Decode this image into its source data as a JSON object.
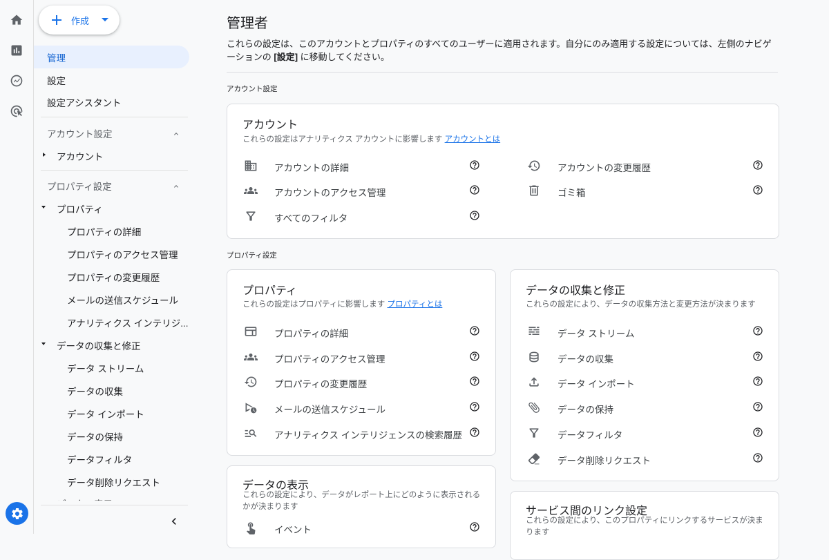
{
  "create": {
    "label": "作成"
  },
  "sidebar": {
    "admin": "管理",
    "settings": "設定",
    "assistant": "設定アシスタント",
    "account_section": "アカウント設定",
    "account_item": "アカウント",
    "property_section": "プロパティ設定",
    "property_item": "プロパティ",
    "property_children": [
      "プロパティの詳細",
      "プロパティのアクセス管理",
      "プロパティの変更履歴",
      "メールの送信スケジュール",
      "アナリティクス インテリジ..."
    ],
    "data_item": "データの収集と修正",
    "data_children": [
      "データ ストリーム",
      "データの収集",
      "データ インポート",
      "データの保持",
      "データフィルタ",
      "データ削除リクエスト"
    ],
    "cut_item": "データの表示"
  },
  "main": {
    "title": "管理者",
    "desc_pre": "これらの設定は、このアカウントとプロパティのすべてのユーザーに適用されます。自分にのみ適用する設定については、左側のナビゲーションの ",
    "desc_bold": "[設定]",
    "desc_post": " に移動してください。",
    "account_group": "アカウント設定",
    "property_group": "プロパティ設定"
  },
  "account_card": {
    "title": "アカウント",
    "sub": "これらの設定はアナリティクス アカウントに影響します ",
    "link": "アカウントとは",
    "left_rows": [
      "アカウントの詳細",
      "アカウントのアクセス管理",
      "すべてのフィルタ"
    ],
    "right_rows": [
      "アカウントの変更履歴",
      "ゴミ箱"
    ]
  },
  "property_card": {
    "title": "プロパティ",
    "sub": "これらの設定はプロパティに影響します ",
    "link": "プロパティとは",
    "rows": [
      "プロパティの詳細",
      "プロパティのアクセス管理",
      "プロパティの変更履歴",
      "メールの送信スケジュール",
      "アナリティクス インテリジェンスの検索履歴"
    ]
  },
  "data_card": {
    "title": "データの収集と修正",
    "sub": "これらの設定により、データの収集方法と変更方法が決まります",
    "rows": [
      "データ ストリーム",
      "データの収集",
      "データ インポート",
      "データの保持",
      "データフィルタ",
      "データ削除リクエスト"
    ]
  },
  "display_card": {
    "title": "データの表示",
    "sub1": "これらの設定により、データがレポート上にどのように表示される",
    "sub2": "かが決まります",
    "rows": [
      "イベント"
    ]
  },
  "link_card": {
    "title": "サービス間のリンク設定",
    "sub1": "これらの設定により、このプロパティにリンクするサービスが決ま",
    "sub2": "ります"
  },
  "colors": {
    "accent": "#1a73e8",
    "active_bg": "#e8f0fe"
  }
}
